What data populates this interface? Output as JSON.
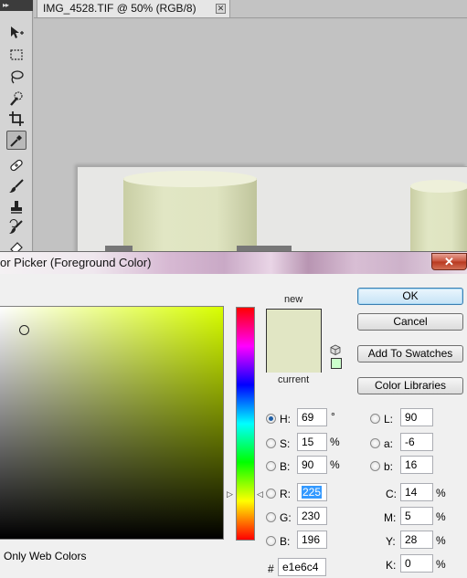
{
  "document": {
    "tab_title": "IMG_4528.TIF @ 50% (RGB/8)",
    "close_glyph": "✕"
  },
  "toolbar": {
    "grip": "▸▸",
    "tools": [
      "move-tool-icon",
      "marquee-tool-icon",
      "lasso-tool-icon",
      "quick-selection-tool-icon",
      "crop-tool-icon",
      "eyedropper-tool-icon",
      "healing-brush-tool-icon",
      "brush-tool-icon",
      "clone-stamp-tool-icon",
      "history-brush-tool-icon",
      "eraser-tool-icon"
    ],
    "active_tool": "eyedropper-tool-icon"
  },
  "dialog": {
    "title": "or Picker (Foreground Color)",
    "close_glyph": "✕",
    "new_label": "new",
    "current_label": "current",
    "new_color": "#e1e6c4",
    "current_color": "#e1e6c4",
    "buttons": {
      "ok": "OK",
      "cancel": "Cancel",
      "add_to_swatches": "Add To Swatches",
      "color_libraries": "Color Libraries"
    },
    "only_web_colors": "Only Web Colors",
    "hsb": {
      "h": {
        "label": "H:",
        "value": "69",
        "unit": "°",
        "checked": true
      },
      "s": {
        "label": "S:",
        "value": "15",
        "unit": "%",
        "checked": false
      },
      "b": {
        "label": "B:",
        "value": "90",
        "unit": "%",
        "checked": false
      }
    },
    "rgb": {
      "r": {
        "label": "R:",
        "value": "225",
        "checked": false
      },
      "g": {
        "label": "G:",
        "value": "230",
        "checked": false
      },
      "b": {
        "label": "B:",
        "value": "196",
        "checked": false
      }
    },
    "lab": {
      "l": {
        "label": "L:",
        "value": "90",
        "checked": false
      },
      "a": {
        "label": "a:",
        "value": "-6",
        "checked": false
      },
      "b": {
        "label": "b:",
        "value": "16",
        "checked": false
      }
    },
    "cmyk": {
      "c": {
        "label": "C:",
        "value": "14",
        "unit": "%"
      },
      "m": {
        "label": "M:",
        "value": "5",
        "unit": "%"
      },
      "y": {
        "label": "Y:",
        "value": "28",
        "unit": "%"
      },
      "k": {
        "label": "K:",
        "value": "0",
        "unit": "%"
      }
    },
    "hex": {
      "label": "#",
      "value": "e1e6c4"
    },
    "hue_color": "#d9ff00"
  }
}
